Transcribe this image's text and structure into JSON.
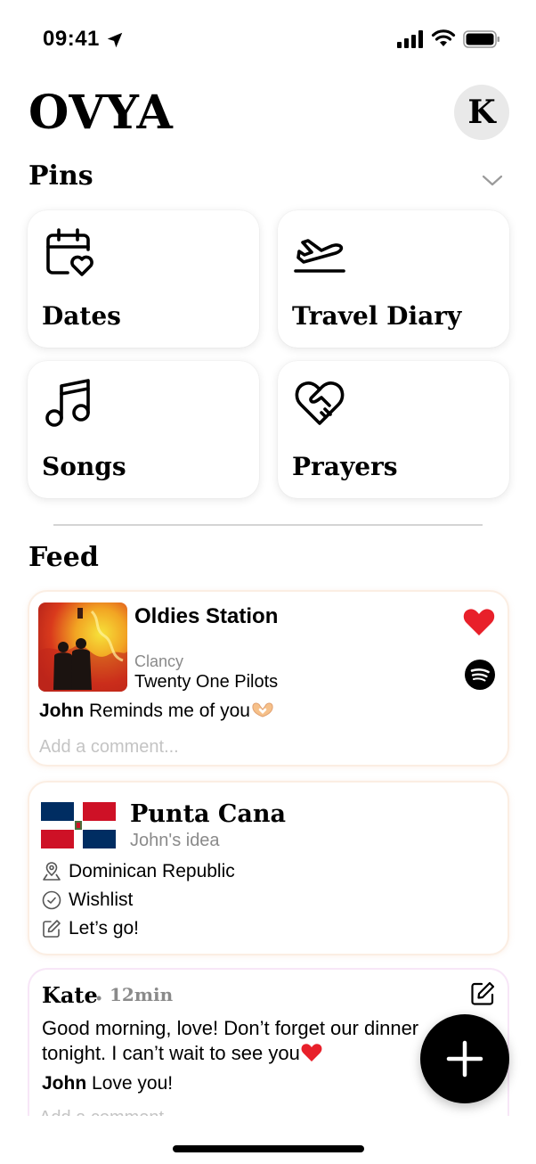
{
  "status_bar": {
    "time": "09:41"
  },
  "header": {
    "app_title": "OVYA",
    "avatar_initial": "K"
  },
  "pins": {
    "title": "Pins",
    "items": [
      {
        "label": "Dates",
        "icon": "calendar-heart-icon"
      },
      {
        "label": "Travel Diary",
        "icon": "airplane-takeoff-icon"
      },
      {
        "label": "Songs",
        "icon": "music-note-icon"
      },
      {
        "label": "Prayers",
        "icon": "heart-handshake-icon"
      }
    ]
  },
  "feed": {
    "title": "Feed",
    "song_card": {
      "station": "Oldies Station",
      "song_title": "Clancy",
      "artist": "Twenty One Pilots",
      "comment_author": "John",
      "comment_text": "Reminds me of you",
      "comment_placeholder": "Add a comment...",
      "liked": true
    },
    "travel_card": {
      "place": "Punta Cana",
      "subtitle": "John's idea",
      "country": "Dominican Republic",
      "status": "Wishlist",
      "note": "Let’s go!"
    },
    "note_card": {
      "author": "Kate",
      "separator": "•",
      "time_ago": "12min",
      "text_line1": "Good morning, love! Don’t forget our dinner",
      "text_line2": "tonight. I can’t wait to see you",
      "reply_author": "John",
      "reply_text": "Love you!",
      "comment_placeholder": "Add a comment..."
    }
  },
  "colors": {
    "heart": "#e8202a",
    "flag_blue": "#002d62",
    "flag_red": "#ce1126",
    "fab": "#000000"
  }
}
